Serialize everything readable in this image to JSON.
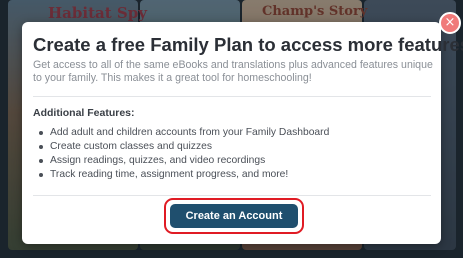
{
  "background": {
    "book_titles": [
      "Habitat Spy",
      "Champ's Story"
    ]
  },
  "modal": {
    "close_symbol": "×",
    "title": "Create a free Family Plan to access more features!",
    "description": "Get access to all of the same eBooks and translations plus advanced features unique to your family. This makes it a great tool for homeschooling!",
    "features_heading": "Additional Features:",
    "features": [
      "Add adult and children accounts from your Family Dashboard",
      "Create custom classes and quizzes",
      "Assign readings, quizzes, and video recordings",
      "Track reading time, assignment progress, and more!"
    ],
    "cta_label": "Create an Account"
  },
  "colors": {
    "cta_background": "#1f4f6e",
    "highlight_ring": "#e01b24",
    "close_button": "#f07a7a",
    "title_text": "#2b2f36",
    "description_text": "#8a8f96"
  }
}
